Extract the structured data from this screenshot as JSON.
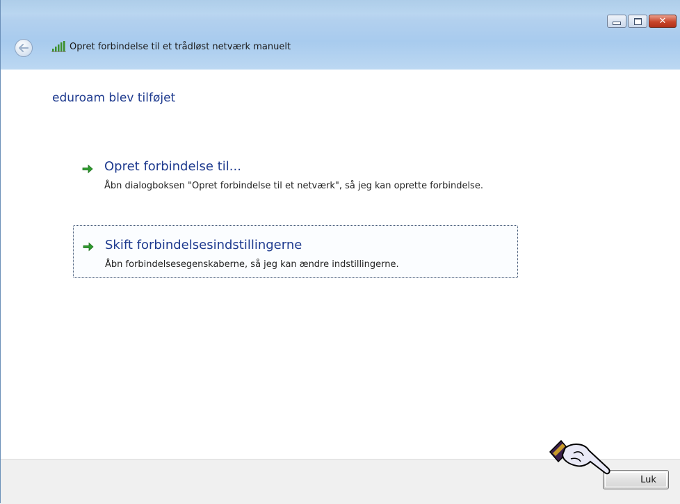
{
  "window": {
    "title": "Opret forbindelse til et trådløst netværk manuelt",
    "back_icon": "back-arrow-icon",
    "signal_icon": "wireless-signal-icon"
  },
  "caption_buttons": {
    "minimize": "minimize-icon",
    "maximize": "maximize-icon",
    "close": "close-icon"
  },
  "main": {
    "heading": "eduroam blev tilføjet",
    "commands": [
      {
        "title": "Opret forbindelse til...",
        "underline_char": "O",
        "description": "Åbn dialogboksen \"Opret forbindelse til et netværk\", så jeg kan oprette forbindelse."
      },
      {
        "title": "Skift forbindelsesindstillingerne",
        "underline_char": "k",
        "description": "Åbn forbindelsesegenskaberne, så jeg kan ændre indstillingerne."
      }
    ]
  },
  "footer": {
    "close_label": "Luk"
  },
  "colors": {
    "heading": "#1f3b8f",
    "arrow": "#2e9b2e",
    "titlebar": "#b2d0ee"
  }
}
